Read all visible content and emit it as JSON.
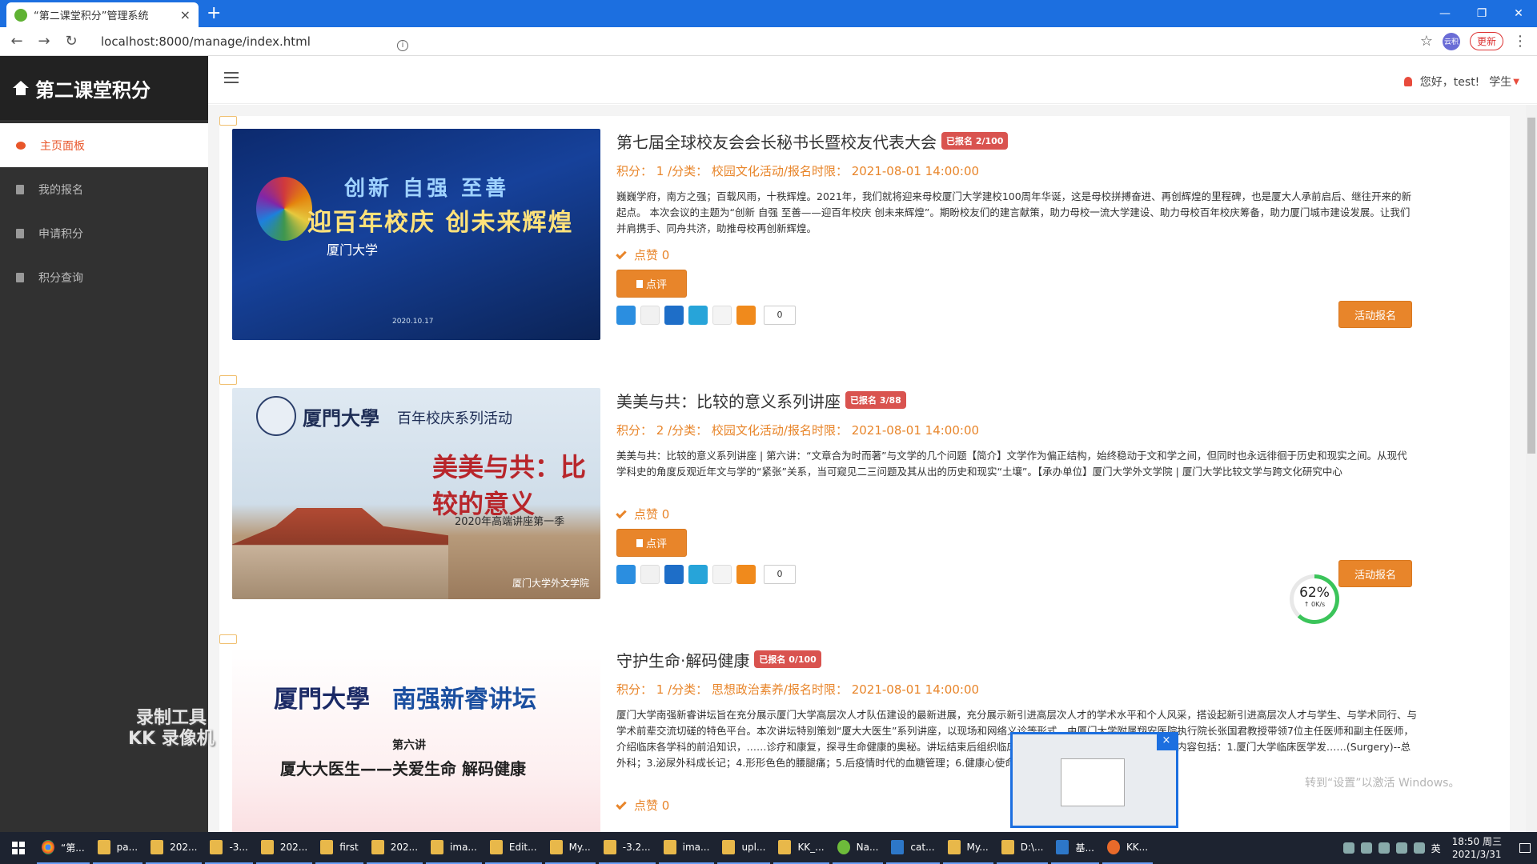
{
  "browser": {
    "tab_title": "“第二课堂积分”管理系统",
    "tab_close": "×",
    "new_tab": "+",
    "url": "localhost:8000/manage/index.html",
    "profile": "云积",
    "update_label": "更新"
  },
  "sidebar": {
    "brand": "第二课堂积分",
    "items": [
      {
        "label": "主页面板"
      },
      {
        "label": "我的报名"
      },
      {
        "label": "申请积分"
      },
      {
        "label": "积分查询"
      }
    ]
  },
  "header": {
    "greeting": "您好，test!",
    "role": "学生"
  },
  "activities": [
    {
      "title": "第七届全球校友会会长秘书长暨校友代表大会",
      "badge": "已报名 2/100",
      "meta": "积分：  1 /分类：  校园文化活动/报名时限：  2021-08-01 14:00:00",
      "desc": "巍巍学府，南方之强；百载风雨，十秩辉煌。2021年，我们就将迎来母校厦门大学建校100周年华诞，这是母校拼搏奋进、再创辉煌的里程碑，也是厦大人承前启后、继往开来的新起点。 本次会议的主题为“创新 自强 至善——迎百年校庆 创未来辉煌”。期盼校友们的建言献策，助力母校一流大学建设、助力母校百年校庆筹备，助力厦门城市建设发展。让我们并肩携手、同舟共济，助推母校再创新辉煌。",
      "likes": "点赞 0",
      "review": "点评",
      "share_count": "0",
      "signup": "活动报名",
      "thumb": {
        "l1": "创新  自强  至善",
        "l2": "迎百年校庆  创未来辉煌",
        "l3": "厦门大学",
        "date": "2020.10.17"
      }
    },
    {
      "title": "美美与共：比较的意义系列讲座",
      "badge": "已报名 3/88",
      "meta": "积分：  2 /分类：  校园文化活动/报名时限：  2021-08-01 14:00:00",
      "desc": "美美与共：比较的意义系列讲座 | 第六讲：“文章合为时而著”与文学的几个问题【简介】文学作为偏正结构，始终稳动于文和学之间，但同时也永远徘徊于历史和现实之间。从现代学科史的角度反观近年文与学的“紧张”关系，当可窥见二三问题及其从出的历史和现实“土壤”。【承办单位】厦门大学外文学院 | 厦门大学比较文学与跨文化研究中心",
      "likes": "点赞 0",
      "review": "点评",
      "share_count": "0",
      "signup": "活动报名",
      "thumb": {
        "h1": "厦門大學",
        "h2": "百年校庆系列活动",
        "h3": "美美与共：比较的意义",
        "h4": "2020年高端讲座第一季",
        "foot": "厦门大学外文学院"
      }
    },
    {
      "title": "守护生命·解码健康",
      "badge": "已报名 0/100",
      "meta": "积分：  1 /分类：  思想政治素养/报名时限：  2021-08-01 14:00:00",
      "desc": "厦门大学南强新睿讲坛旨在充分展示厦门大学高层次人才队伍建设的最新进展，充分展示新引进高层次人才的学术水平和个人风采，搭设起新引进高层次人才与学生、与学术同行、与学术前辈交流切磋的特色平台。本次讲坛特别策划“厦大大医生”系列讲座，以现场和网络义诊等形式，由厦门大学附属翔安医院执行院长张国君教授带领7位主任医师和副主任医师，介绍临床各学科的前沿知识，……诊疗和康复，探寻生命健康的奥秘。讲坛结束后组织临床科室医师开展现场及网络义诊。演讲内容包括：1.厦门大学临床医学发……(Surgery)--总外科；3.泌尿外科成长记；4.形形色色的腰腿痛；5.后疫情时代的血糖管理；6.健康心使命，逐梦心世界；7.镜中乾坤",
      "likes": "点赞 0",
      "thumb": {
        "h1": "厦門大學",
        "h2": "南强新睿讲坛",
        "h3": "第六讲",
        "h4": "厦大大医生——关爱生命 解码健康"
      }
    }
  ],
  "overlay": {
    "recorder_line1": "录制工具",
    "recorder_line2": "KK 录像机",
    "progress_pct": "62%",
    "progress_rate": "↑ 0K/s",
    "progress_value": 62,
    "popup_close": "×",
    "win_watermark": "转到“设置”以激活 Windows。"
  },
  "taskbar": {
    "items": [
      "“第...",
      "pa...",
      "202...",
      "-3...",
      "202...",
      "first",
      "202...",
      "ima...",
      "Edit...",
      "My...",
      "-3.2...",
      "ima...",
      "upl...",
      "KK_...",
      "Na...",
      "cat...",
      "My...",
      "D:\\...",
      "基...",
      "KK..."
    ],
    "ime": "英",
    "time": "18:50 周三",
    "date": "2021/3/31"
  },
  "colors": {
    "accent": "#e8852a",
    "badge": "#d9534f",
    "sidebar": "#313131",
    "titlebar": "#1c6fe0"
  },
  "icons": [
    "home-icon",
    "dashboard-icon",
    "file-icon",
    "user-icon",
    "check-icon",
    "share-icons"
  ]
}
